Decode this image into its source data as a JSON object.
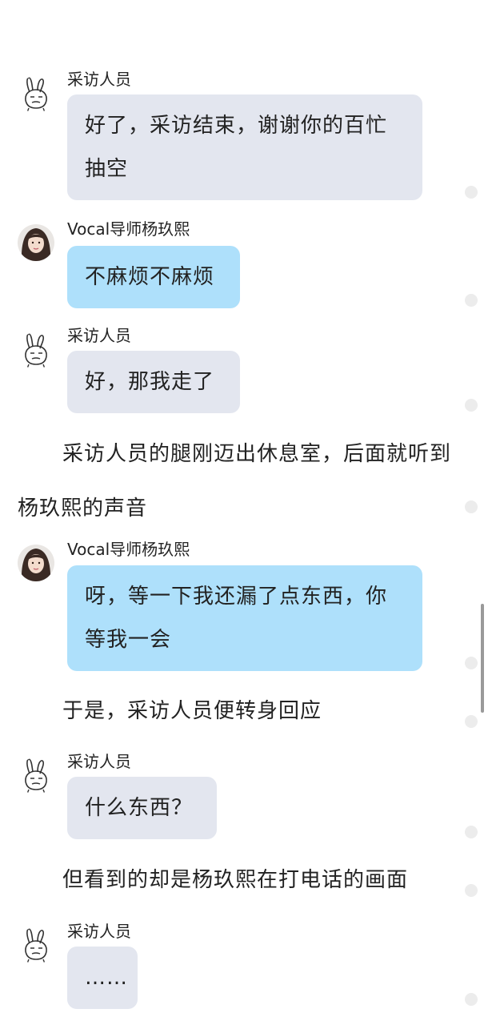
{
  "messages": [
    {
      "sender": "采访人员",
      "text": "好了，采访结束，谢谢你的百忙抽空",
      "avatar": "rabbit-icon"
    },
    {
      "sender": "Vocal导师杨玖熙",
      "text": "不麻烦不麻烦",
      "avatar": "woman-photo"
    },
    {
      "sender": "采访人员",
      "text": "好，那我走了",
      "avatar": "rabbit-icon"
    },
    {
      "sender": "Vocal导师杨玖熙",
      "text": "呀，等一下我还漏了点东西，你等我一会",
      "avatar": "woman-photo"
    },
    {
      "sender": "采访人员",
      "text": "什么东西？",
      "avatar": "rabbit-icon"
    },
    {
      "sender": "采访人员",
      "text": "……",
      "avatar": "rabbit-icon"
    }
  ],
  "narrations": [
    "采访人员的腿刚迈出休息室，后面就听到杨玖熙的声音",
    "于是，采访人员便转身回应",
    "但看到的却是杨玖熙在打电话的画面"
  ],
  "colors": {
    "bubble_gray": "#e3e6ef",
    "bubble_blue": "#aee0fb",
    "text": "#222222"
  }
}
